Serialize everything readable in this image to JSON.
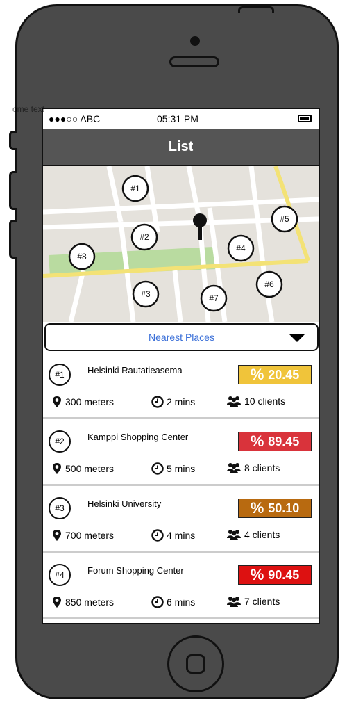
{
  "overlay_label": "ome text",
  "status_bar": {
    "carrier": "●●●○○ ABC",
    "time": "05:31 PM"
  },
  "nav": {
    "title": "List"
  },
  "map": {
    "pins": [
      "#1",
      "#2",
      "#3",
      "#4",
      "#5",
      "#6",
      "#7",
      "#8"
    ]
  },
  "filter": {
    "selected": "Nearest Places"
  },
  "places": [
    {
      "num": "#1",
      "name": "Helsinki Rautatieasema",
      "percent": "20.45",
      "color": "#f0c43a",
      "distance": "300 meters",
      "time": "2 mins",
      "clients": "10 clients"
    },
    {
      "num": "#2",
      "name": "Kamppi Shopping Center",
      "percent": "89.45",
      "color": "#d9333b",
      "distance": "500 meters",
      "time": "5 mins",
      "clients": "8 clients"
    },
    {
      "num": "#3",
      "name": "Helsinki University",
      "percent": "50.10",
      "color": "#b86a10",
      "distance": "700 meters",
      "time": "4 mins",
      "clients": "4 clients"
    },
    {
      "num": "#4",
      "name": "Forum Shopping Center",
      "percent": "90.45",
      "color": "#dd1111",
      "distance": "850 meters",
      "time": "6 mins",
      "clients": "7 clients"
    }
  ],
  "percent_symbol": "%"
}
